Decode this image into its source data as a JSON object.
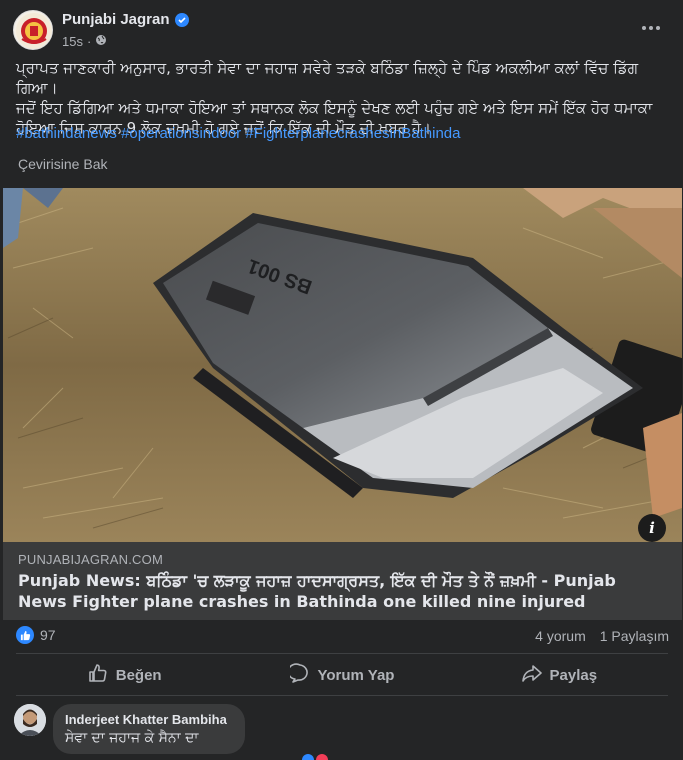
{
  "post": {
    "author": "Punjabi Jagran",
    "timestamp": "15s",
    "text_line1": "ਪ੍ਰਾਪਤ ਜਾਣਕਾਰੀ ਅਨੁਸਾਰ, ਭਾਰਤੀ ਸੇਵਾ ਦਾ ਜਹਾਜ਼ ਸਵੇਰੇ ਤੜਕੇ ਬਠਿੰਡਾ ਜ਼ਿਲ੍ਹੇ ਦੇ ਪਿੰਡ ਅਕਲੀਆ ਕਲਾਂ ਵਿੱਚ ਡਿੱਗ ਗਿਆ।",
    "text_line2": "ਜਦੋਂ ਇਹ ਡਿੱਗਿਆ ਅਤੇ ਧਮਾਕਾ ਹੋਇਆ ਤਾਂ ਸਥਾਨਕ ਲੋਕ ਇਸਨੂੰ ਦੇਖਣ ਲਈ ਪਹੁੰਚ ਗਏ ਅਤੇ ਇਸ ਸਮੇਂ ਇੱਕ ਹੋਰ ਧਮਾਕਾ",
    "text_line3": "ਹੋਇਆ ਜਿਸ ਕਾਰਨ 9 ਲੋਕ ਜ਼ਖ਼ਮੀ ਹੋ ਗਏ ਜਦੋਂ ਕਿ ਇੱਕ ਦੀ ਮੌਤ ਦੀ ਖ਼ਬਰ ਹੈ।",
    "hashtags": "#bathindanews #operationsindoor #FighterplanecrashesinBathinda",
    "translate_label": "Çevirisine Bak"
  },
  "photo": {
    "wreck_marking": "BS 001",
    "info_icon_label": "i"
  },
  "link": {
    "domain": "PUNJABIJAGRAN.COM",
    "title_line1": "Punjab News: ਬਠਿੰਡਾ 'ਚ ਲੜਾਕੂ ਜਹਾਜ਼ ਹਾਦਸਾਗ੍ਰਸਤ, ਇੱਕ ਦੀ ਮੌਤ ਤੇ ਨੌਂ ਜ਼ਖ਼ਮੀ - Punjab",
    "title_line2": "News Fighter plane crashes in Bathinda one killed nine injured"
  },
  "stats": {
    "like_count": "97",
    "comments": "4 yorum",
    "shares": "1 Paylaşım"
  },
  "actions": {
    "like": "Beğen",
    "comment": "Yorum Yap",
    "share": "Paylaş"
  },
  "comment": {
    "author": "Inderjeet Khatter Bambiha",
    "text": "ਸੇਵਾ ਦਾ ਜਹਾਜ ਕੇ ਸੈਨਾ ਦਾ"
  },
  "colors": {
    "background": "#242526",
    "link_blue": "#4599ff",
    "like_blue": "#2d88ff",
    "card": "#3a3b3c"
  }
}
